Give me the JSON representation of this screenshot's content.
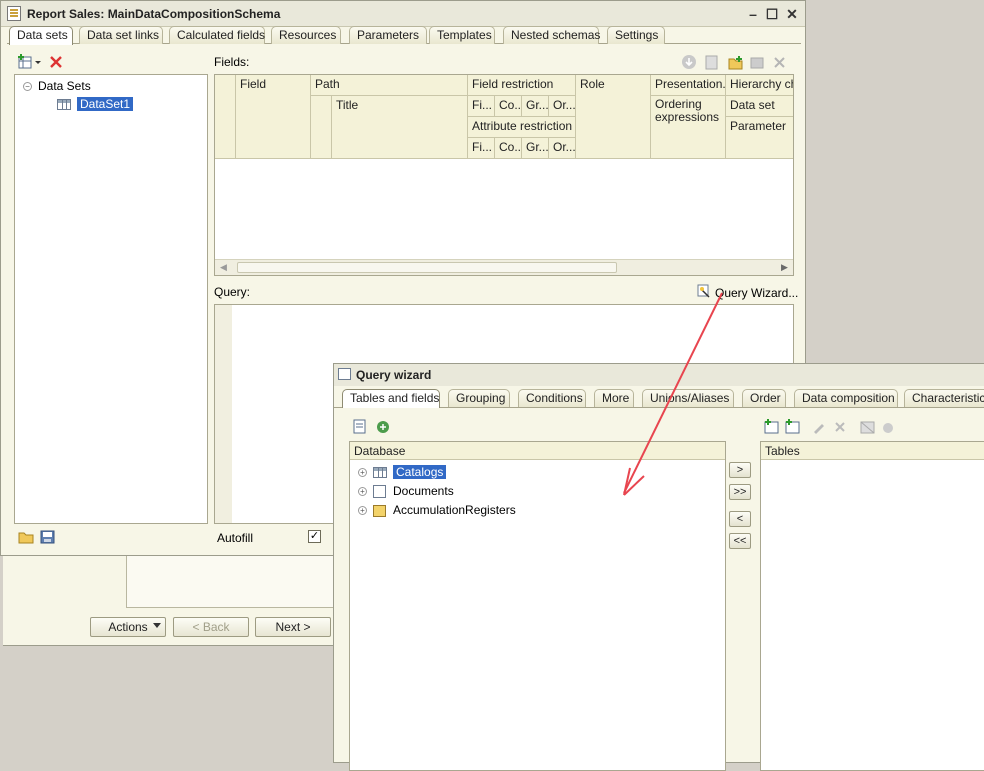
{
  "main_window": {
    "title": "Report Sales: MainDataCompositionSchema",
    "tabs": [
      "Data sets",
      "Data set links",
      "Calculated fields",
      "Resources",
      "Parameters",
      "Templates",
      "Nested schemas",
      "Settings"
    ],
    "tree": {
      "root_label": "Data Sets",
      "item_label": "DataSet1"
    },
    "fields_label": "Fields:",
    "grid": {
      "field": "Field",
      "path": "Path",
      "title": "Title",
      "field_restriction": "Field restriction",
      "fr_cols": [
        "Fi...",
        "Co...",
        "Gr...",
        "Or..."
      ],
      "attribute_restriction": "Attribute restriction",
      "ar_cols": [
        "Fi...",
        "Co...",
        "Gr...",
        "Or..."
      ],
      "role": "Role",
      "presentation": "Presentation...",
      "ordering_expressions": "Ordering expressions",
      "hierarchy": "Hierarchy che",
      "data_set": "Data set",
      "parameter": "Parameter"
    },
    "query_label": "Query:",
    "query_wizard_link": "Query Wizard...",
    "autofill_label": "Autofill",
    "autofill_checked": true
  },
  "bottom_buttons": {
    "actions": "Actions",
    "back": "< Back",
    "next": "Next >"
  },
  "query_wizard": {
    "title": "Query wizard",
    "tabs": [
      "Tables and fields",
      "Grouping",
      "Conditions",
      "More",
      "Unions/Aliases",
      "Order",
      "Data composition",
      "Characteristics"
    ],
    "database_header": "Database",
    "tables_header": "Tables",
    "tree_items": [
      "Catalogs",
      "Documents",
      "AccumulationRegisters"
    ],
    "move_buttons": [
      ">",
      ">>",
      "<",
      "<<"
    ]
  },
  "colors": {
    "selection": "#3169c6",
    "annotation_arrow": "#e8454f",
    "window_bg": "#f7f6e7"
  }
}
